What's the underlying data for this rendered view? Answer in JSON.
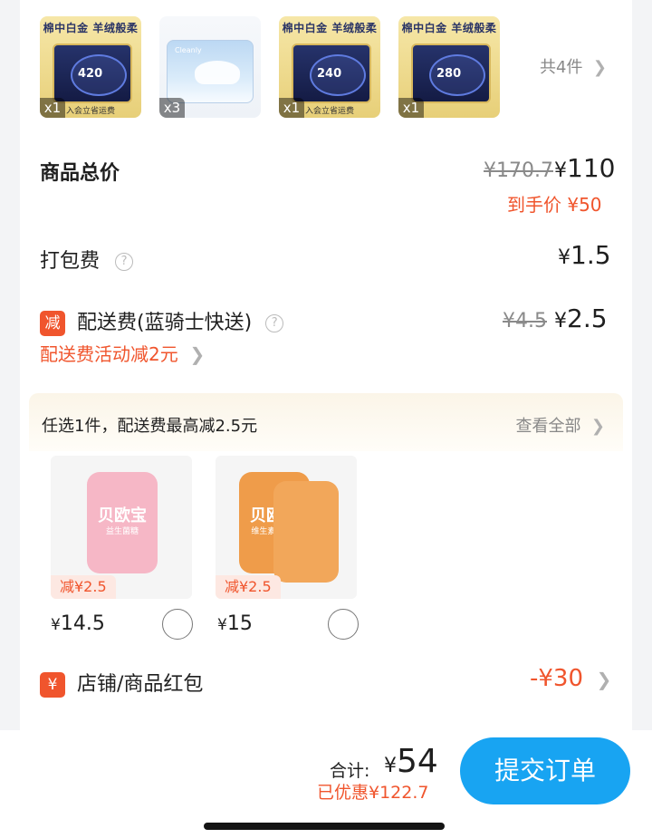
{
  "products": [
    {
      "style": "gold",
      "band": "棉中白金 羊绒般柔软",
      "num": "420",
      "foot": "入会立省运费",
      "qty": "x1"
    },
    {
      "style": "blue",
      "brand": "Cleanly",
      "qty": "x3"
    },
    {
      "style": "gold",
      "band": "棉中白金 羊绒般柔软",
      "num": "240",
      "foot": "入会立省运费",
      "qty": "x1"
    },
    {
      "style": "gold",
      "band": "棉中白金 羊绒般柔软",
      "num": "280",
      "foot": "",
      "qty": "x1"
    }
  ],
  "items_count_label": "共4件",
  "goods_total": {
    "label": "商品总价",
    "old_price": "¥170.7",
    "price_yen": "¥",
    "price": "110",
    "final_label": "到手价 ¥50"
  },
  "packing": {
    "label": "打包费",
    "price_yen": "¥",
    "price": "1.5"
  },
  "delivery": {
    "tag": "减",
    "label": "配送费(蓝骑士快送)",
    "old_price": "¥4.5",
    "price_yen": "¥",
    "price": "2.5",
    "promo": "配送费活动减2元"
  },
  "promo_bar": {
    "text": "任选1件，配送费最高减2.5元",
    "view_all": "查看全部"
  },
  "gifts": [
    {
      "brand": "贝欧宝",
      "sub": "益生菌糖",
      "off": "减¥2.5",
      "price_yen": "¥",
      "price": "14.5",
      "color": "#f6b7c6"
    },
    {
      "brand": "贝欧宝",
      "sub": "维生素C软糖",
      "off": "减¥2.5",
      "price_yen": "¥",
      "price": "15",
      "color": "#ef9c4a"
    }
  ],
  "red_packet": {
    "tag": "¥",
    "label": "店铺/商品红包",
    "value": "-¥30"
  },
  "checkout": {
    "total_label": "合计:",
    "total_yen": "¥",
    "total_value": "54",
    "saved": "已优惠¥122.7",
    "submit": "提交订单"
  },
  "colors": {
    "accent_red": "#f0552d",
    "submit_blue": "#18a4f2"
  }
}
